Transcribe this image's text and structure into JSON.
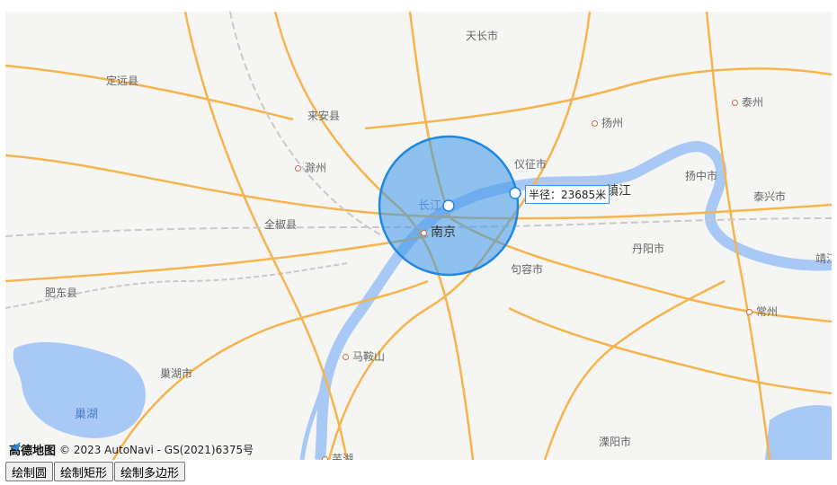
{
  "map": {
    "cities": [
      {
        "id": "tianchang",
        "label": "天长市",
        "dot": false,
        "major": false
      },
      {
        "id": "dingyuan",
        "label": "定远县",
        "dot": false,
        "major": false
      },
      {
        "id": "laian",
        "label": "来安县",
        "dot": false,
        "major": false
      },
      {
        "id": "chuzhou",
        "label": "滁州",
        "dot": true,
        "major": false
      },
      {
        "id": "quanjiao",
        "label": "全椒县",
        "dot": false,
        "major": false
      },
      {
        "id": "yizheng",
        "label": "仪征市",
        "dot": false,
        "major": false
      },
      {
        "id": "yangzhou",
        "label": "扬州",
        "dot": true,
        "major": false
      },
      {
        "id": "taizhou",
        "label": "泰州",
        "dot": true,
        "major": false
      },
      {
        "id": "yangzhong",
        "label": "扬中市",
        "dot": false,
        "major": false
      },
      {
        "id": "taixing",
        "label": "泰兴市",
        "dot": false,
        "major": false
      },
      {
        "id": "zhenjiang",
        "label": "镇江",
        "dot": false,
        "major": true
      },
      {
        "id": "nanjing",
        "label": "南京",
        "dot": true,
        "major": true
      },
      {
        "id": "jurong",
        "label": "句容市",
        "dot": false,
        "major": false
      },
      {
        "id": "danyang",
        "label": "丹阳市",
        "dot": false,
        "major": false
      },
      {
        "id": "changzhou",
        "label": "常州",
        "dot": true,
        "major": false
      },
      {
        "id": "jingjiang",
        "label": "靖江",
        "dot": false,
        "major": false
      },
      {
        "id": "feidong",
        "label": "肥东县",
        "dot": false,
        "major": false
      },
      {
        "id": "maanshan",
        "label": "马鞍山",
        "dot": true,
        "major": false
      },
      {
        "id": "chaohushi",
        "label": "巢湖市",
        "dot": false,
        "major": false
      },
      {
        "id": "liyang",
        "label": "溧阳市",
        "dot": false,
        "major": false
      },
      {
        "id": "wuhu",
        "label": "芜湖",
        "dot": true,
        "major": false
      }
    ],
    "river_label": "长江",
    "lake_label": "巢湖",
    "circle": {
      "radius_text": "半径：23685米",
      "fill": "#3b95ea",
      "stroke": "#1e88e5"
    },
    "attribution": {
      "logo_text": "高德地图",
      "copyright": "© 2023 AutoNavi - GS(2021)6375号"
    }
  },
  "controls": {
    "draw_circle": "绘制圆",
    "draw_rect": "绘制矩形",
    "draw_polygon": "绘制多边形"
  },
  "colors": {
    "road_major": "#f7b44c",
    "road_rail": "#c9c9c9",
    "water": "#a8c8f5",
    "accent": "#3b95ea"
  }
}
